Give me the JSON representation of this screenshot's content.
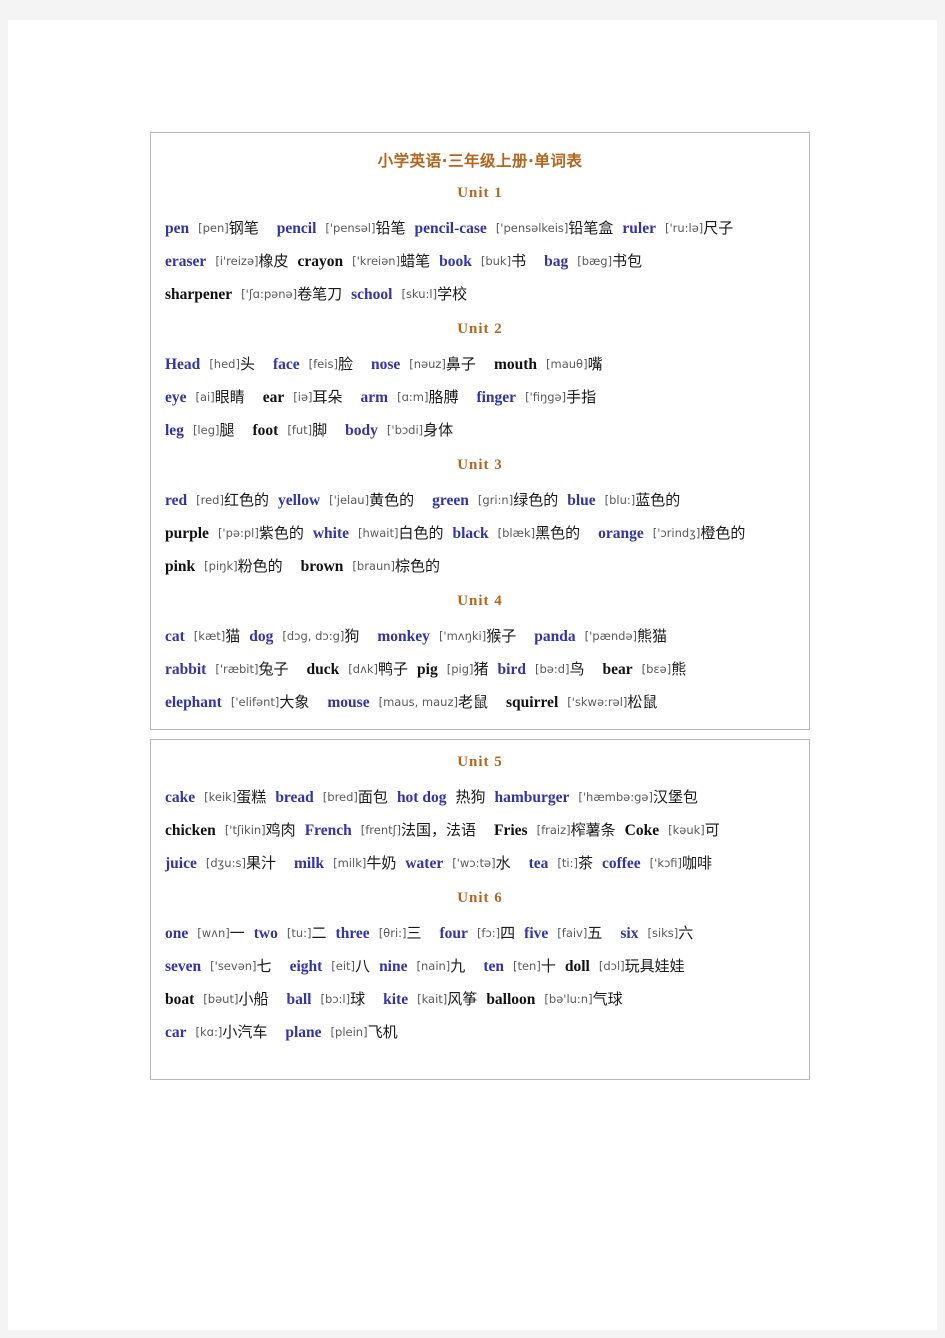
{
  "document": {
    "title": "小学英语·三年级上册·单词表"
  },
  "boxes": [
    {
      "units": [
        {
          "heading": "Unit 1",
          "lines": [
            [
              {
                "word": "pen",
                "color": "blue",
                "phonetic": "[pen]",
                "cn": "钢笔",
                "gap": "wide"
              },
              {
                "word": "pencil",
                "color": "blue",
                "phonetic": "['pensəl]",
                "cn": "铅笔",
                "gap": "normal"
              },
              {
                "word": "pencil-case",
                "color": "blue",
                "phonetic": "['pensəlkeis]",
                "cn": "铅笔盒",
                "gap": "normal"
              },
              {
                "word": "ruler",
                "color": "blue",
                "phonetic": "['ru:lə]",
                "cn": "尺子",
                "gap": "normal"
              }
            ],
            [
              {
                "word": "eraser",
                "color": "blue",
                "phonetic": "[i'reizə]",
                "cn": "橡皮",
                "gap": "normal"
              },
              {
                "word": "crayon",
                "color": "black",
                "phonetic": "['kreiən]",
                "cn": "蜡笔",
                "gap": "normal"
              },
              {
                "word": "book",
                "color": "blue",
                "phonetic": "[buk]",
                "cn": "书",
                "gap": "wide"
              },
              {
                "word": "bag",
                "color": "blue",
                "phonetic": "[bæg]",
                "cn": "书包",
                "gap": "normal"
              }
            ],
            [
              {
                "word": "sharpener",
                "color": "black",
                "phonetic": "['ʃɑ:pənə]",
                "cn": "卷笔刀",
                "gap": "normal"
              },
              {
                "word": "school",
                "color": "blue",
                "phonetic": "[sku:l]",
                "cn": "学校",
                "gap": "normal"
              }
            ]
          ]
        },
        {
          "heading": "Unit 2",
          "lines": [
            [
              {
                "word": "Head",
                "color": "blue",
                "phonetic": "[hed]",
                "cn": "头",
                "gap": "wide"
              },
              {
                "word": "face",
                "color": "blue",
                "phonetic": "[feis]",
                "cn": "脸",
                "gap": "wide"
              },
              {
                "word": "nose",
                "color": "blue",
                "phonetic": "[nəuz]",
                "cn": "鼻子",
                "gap": "wide"
              },
              {
                "word": "mouth",
                "color": "black",
                "phonetic": "[mauθ]",
                "cn": "嘴",
                "gap": "normal"
              }
            ],
            [
              {
                "word": "eye",
                "color": "blue",
                "phonetic": "[ai]",
                "cn": "眼睛",
                "gap": "wide"
              },
              {
                "word": "ear",
                "color": "black",
                "phonetic": "[iə]",
                "cn": "耳朵",
                "gap": "wide"
              },
              {
                "word": "arm",
                "color": "blue",
                "phonetic": "[ɑ:m]",
                "cn": "胳膊",
                "gap": "wide"
              },
              {
                "word": "finger",
                "color": "blue",
                "phonetic": "['fiŋgə]",
                "cn": "手指",
                "gap": "normal"
              }
            ],
            [
              {
                "word": "leg",
                "color": "blue",
                "phonetic": "[leg]",
                "cn": "腿",
                "gap": "wide"
              },
              {
                "word": "foot",
                "color": "black",
                "phonetic": "[fut]",
                "cn": "脚",
                "gap": "wide"
              },
              {
                "word": "body",
                "color": "blue",
                "phonetic": "['bɔdi]",
                "cn": "身体",
                "gap": "normal"
              }
            ]
          ]
        },
        {
          "heading": "Unit 3",
          "lines": [
            [
              {
                "word": "red",
                "color": "blue",
                "phonetic": "[red]",
                "cn": "红色的",
                "gap": "normal"
              },
              {
                "word": "yellow",
                "color": "blue",
                "phonetic": "['jelau]",
                "cn": "黄色的",
                "gap": "wide"
              },
              {
                "word": "green",
                "color": "blue",
                "phonetic": "[gri:n]",
                "cn": "绿色的",
                "gap": "normal"
              },
              {
                "word": "blue",
                "color": "blue",
                "phonetic": "[blu:]",
                "cn": "蓝色的",
                "gap": "normal"
              }
            ],
            [
              {
                "word": "purple",
                "color": "black",
                "phonetic": "['pə:pl]",
                "cn": "紫色的",
                "gap": "normal"
              },
              {
                "word": "white",
                "color": "blue",
                "phonetic": "[hwait]",
                "cn": "白色的",
                "gap": "normal"
              },
              {
                "word": "black",
                "color": "blue",
                "phonetic": "[blæk]",
                "cn": "黑色的",
                "gap": "wide"
              },
              {
                "word": "orange",
                "color": "blue",
                "phonetic": "['ɔrindʒ]",
                "cn": "橙色的",
                "gap": "normal"
              }
            ],
            [
              {
                "word": "pink",
                "color": "black",
                "phonetic": "[piŋk]",
                "cn": "粉色的",
                "gap": "wide"
              },
              {
                "word": "brown",
                "color": "black",
                "phonetic": "[braun]",
                "cn": "棕色的",
                "gap": "normal"
              }
            ]
          ]
        },
        {
          "heading": "Unit 4",
          "lines": [
            [
              {
                "word": "cat",
                "color": "blue",
                "phonetic": "[kæt]",
                "cn": "猫",
                "gap": "normal"
              },
              {
                "word": "dog",
                "color": "blue",
                "phonetic": "[dɔg, dɔ:g]",
                "cn": "狗",
                "gap": "wide"
              },
              {
                "word": "monkey",
                "color": "blue",
                "phonetic": "['mʌŋki]",
                "cn": "猴子",
                "gap": "wide"
              },
              {
                "word": "panda",
                "color": "blue",
                "phonetic": "['pændə]",
                "cn": "熊猫",
                "gap": "normal"
              }
            ],
            [
              {
                "word": "rabbit",
                "color": "blue",
                "phonetic": "['ræbit]",
                "cn": "兔子",
                "gap": "wide"
              },
              {
                "word": "duck",
                "color": "black",
                "phonetic": "[dʌk]",
                "cn": "鸭子",
                "gap": "normal"
              },
              {
                "word": "pig",
                "color": "black",
                "phonetic": "[pig]",
                "cn": "猪",
                "gap": "normal"
              },
              {
                "word": "bird",
                "color": "blue",
                "phonetic": "[bə:d]",
                "cn": "鸟",
                "gap": "wide"
              },
              {
                "word": "bear",
                "color": "black",
                "phonetic": "[bɛə]",
                "cn": "熊",
                "gap": "normal"
              }
            ],
            [
              {
                "word": "elephant",
                "color": "blue",
                "phonetic": "['elifənt]",
                "cn": "大象",
                "gap": "wide"
              },
              {
                "word": "mouse",
                "color": "blue",
                "phonetic": "[maus, mauz]",
                "cn": "老鼠",
                "gap": "wide"
              },
              {
                "word": "squirrel",
                "color": "black",
                "phonetic": "['skwə:rəl]",
                "cn": "松鼠",
                "gap": "normal"
              }
            ]
          ]
        }
      ]
    },
    {
      "units": [
        {
          "heading": "Unit 5",
          "lines": [
            [
              {
                "word": "cake",
                "color": "blue",
                "phonetic": "[keik]",
                "cn": "蛋糕",
                "gap": "normal"
              },
              {
                "word": "bread",
                "color": "blue",
                "phonetic": "[bred]",
                "cn": "面包",
                "gap": "normal"
              },
              {
                "word": "hot dog",
                "color": "blue",
                "phonetic": "",
                "cn": "热狗",
                "gap": "normal"
              },
              {
                "word": "hamburger",
                "color": "blue",
                "phonetic": "['hæmbə:gə]",
                "cn": "汉堡包",
                "gap": "wide"
              }
            ],
            [
              {
                "word": "chicken",
                "color": "black",
                "phonetic": "['tʃikin]",
                "cn": "鸡肉",
                "gap": "normal"
              },
              {
                "word": "French",
                "color": "blue",
                "phonetic": "[frentʃ]",
                "cn": "法国，法语",
                "gap": "wide"
              },
              {
                "word": "Fries",
                "color": "black",
                "phonetic": "[fraiz]",
                "cn": "榨薯条",
                "gap": "normal"
              },
              {
                "word": "Coke",
                "color": "black",
                "phonetic": "[kəuk]",
                "cn": "可",
                "gap": "normal"
              }
            ],
            [
              {
                "word": "juice",
                "color": "blue",
                "phonetic": "[dʒu:s]",
                "cn": "果汁",
                "gap": "wide"
              },
              {
                "word": "milk",
                "color": "blue",
                "phonetic": "[milk]",
                "cn": "牛奶",
                "gap": "normal"
              },
              {
                "word": "water",
                "color": "blue",
                "phonetic": "['wɔ:tə]",
                "cn": "水",
                "gap": "wide"
              },
              {
                "word": "tea",
                "color": "blue",
                "phonetic": "[ti:]",
                "cn": "茶",
                "gap": "normal"
              },
              {
                "word": "coffee",
                "color": "blue",
                "phonetic": "['kɔfi]",
                "cn": "咖啡",
                "gap": "normal"
              }
            ]
          ]
        },
        {
          "heading": "Unit 6",
          "lines": [
            [
              {
                "word": "one",
                "color": "blue",
                "phonetic": "[wʌn]",
                "cn": "一",
                "gap": "normal"
              },
              {
                "word": "two",
                "color": "blue",
                "phonetic": "[tu:]",
                "cn": "二",
                "gap": "normal"
              },
              {
                "word": "three",
                "color": "blue",
                "phonetic": "[θri:]",
                "cn": "三",
                "gap": "wide"
              },
              {
                "word": "four",
                "color": "blue",
                "phonetic": "[fɔ:]",
                "cn": "四",
                "gap": "normal"
              },
              {
                "word": "five",
                "color": "blue",
                "phonetic": "[faiv]",
                "cn": "五",
                "gap": "wide"
              },
              {
                "word": "six",
                "color": "blue",
                "phonetic": "[siks]",
                "cn": "六",
                "gap": "normal"
              }
            ],
            [
              {
                "word": "seven",
                "color": "blue",
                "phonetic": "['sevən]",
                "cn": "七",
                "gap": "wide"
              },
              {
                "word": "eight",
                "color": "blue",
                "phonetic": "[eit]",
                "cn": "八",
                "gap": "normal"
              },
              {
                "word": "nine",
                "color": "blue",
                "phonetic": "[nain]",
                "cn": "九",
                "gap": "wide"
              },
              {
                "word": "ten",
                "color": "blue",
                "phonetic": "[ten]",
                "cn": "十",
                "gap": "normal"
              },
              {
                "word": "doll",
                "color": "black",
                "phonetic": "[dɔl]",
                "cn": "玩具娃娃",
                "gap": "normal"
              }
            ],
            [
              {
                "word": "boat",
                "color": "black",
                "phonetic": "[bəut]",
                "cn": "小船",
                "gap": "wide"
              },
              {
                "word": "ball",
                "color": "blue",
                "phonetic": "[bɔ:l]",
                "cn": "球",
                "gap": "wide"
              },
              {
                "word": "kite",
                "color": "blue",
                "phonetic": "[kait]",
                "cn": "风筝",
                "gap": "normal"
              },
              {
                "word": "balloon",
                "color": "black",
                "phonetic": "[bə'lu:n]",
                "cn": "气球",
                "gap": "normal"
              }
            ],
            [
              {
                "word": "car",
                "color": "blue",
                "phonetic": "[kɑ:]",
                "cn": "小汽车",
                "gap": "wide"
              },
              {
                "word": "plane",
                "color": "blue",
                "phonetic": "[plein]",
                "cn": "飞机",
                "gap": "normal"
              }
            ]
          ]
        }
      ]
    }
  ]
}
